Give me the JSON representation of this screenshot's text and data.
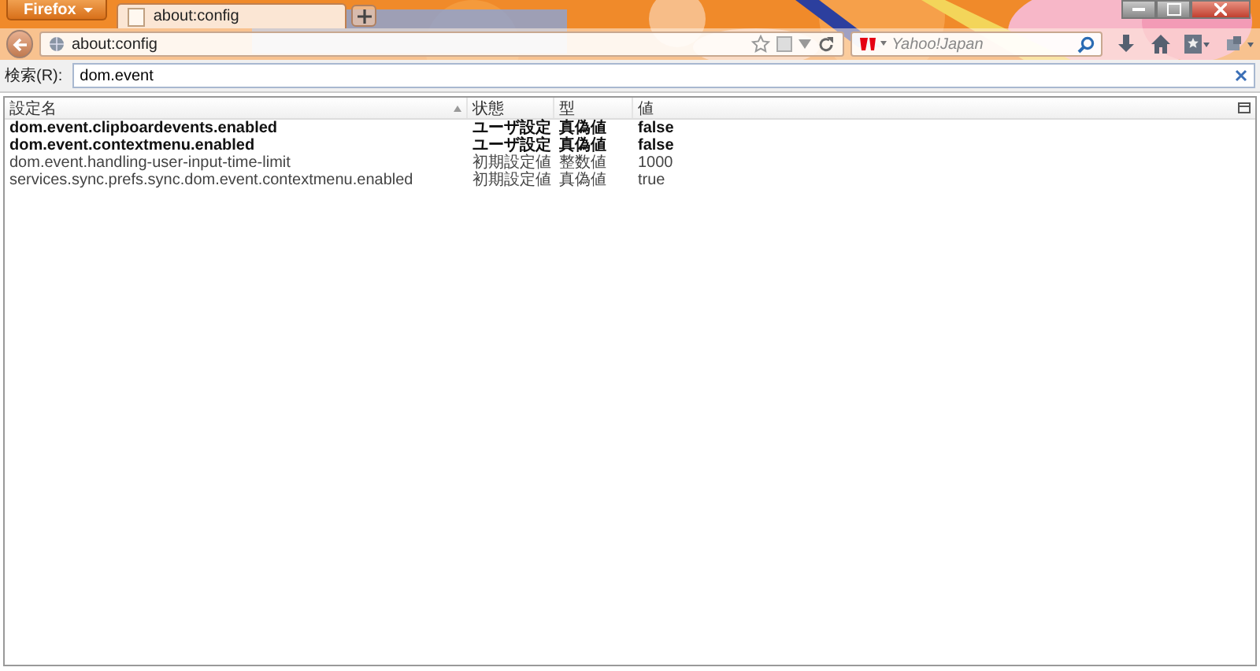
{
  "browser": {
    "menu_button": "Firefox",
    "tabs": [
      {
        "title": "about:config",
        "selected": true
      }
    ],
    "address": "about:config",
    "search_placeholder": "Yahoo!Japan"
  },
  "filter": {
    "label": "検索(R):",
    "value": "dom.event"
  },
  "table": {
    "columns": [
      {
        "label": "設定名",
        "sorted": true
      },
      {
        "label": "状態",
        "sorted": false
      },
      {
        "label": "型",
        "sorted": false
      },
      {
        "label": "値",
        "sorted": false
      }
    ],
    "rows": [
      {
        "name": "dom.event.clipboardevents.enabled",
        "status": "ユーザ設定",
        "type": "真偽値",
        "value": "false",
        "modified": true
      },
      {
        "name": "dom.event.contextmenu.enabled",
        "status": "ユーザ設定",
        "type": "真偽値",
        "value": "false",
        "modified": true
      },
      {
        "name": "dom.event.handling-user-input-time-limit",
        "status": "初期設定値",
        "type": "整数値",
        "value": "1000",
        "modified": false
      },
      {
        "name": "services.sync.prefs.sync.dom.event.contextmenu.enabled",
        "status": "初期設定値",
        "type": "真偽値",
        "value": "true",
        "modified": false
      }
    ]
  }
}
